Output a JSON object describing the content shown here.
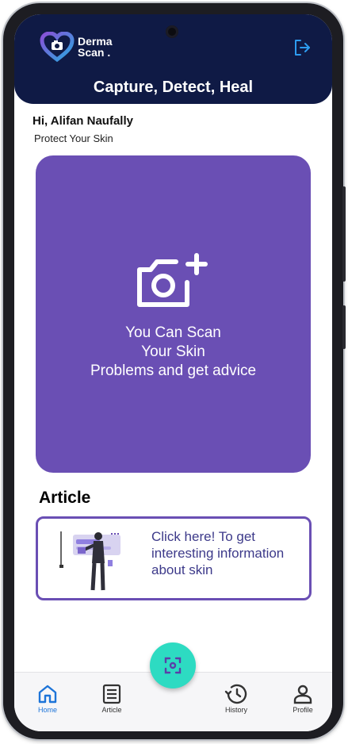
{
  "header": {
    "logo_line1": "Derma",
    "logo_line2": "Scan .",
    "title": "Capture, Detect, Heal",
    "logout_icon": "logout-icon"
  },
  "greeting": {
    "hello": "Hi, Alifan Naufally",
    "subtitle": "Protect Your Skin"
  },
  "scan_card": {
    "icon": "add-camera-icon",
    "line1": "You Can Scan",
    "line2": "Your Skin",
    "line3": "Problems and get advice"
  },
  "article": {
    "heading": "Article",
    "card_text": "Click here! To get interesting information about skin"
  },
  "bottom_nav": {
    "items": [
      {
        "label": "Home",
        "icon": "home-icon",
        "active": true
      },
      {
        "label": "Article",
        "icon": "article-icon",
        "active": false
      },
      {
        "label": "History",
        "icon": "history-icon",
        "active": false
      },
      {
        "label": "Profile",
        "icon": "profile-icon",
        "active": false
      }
    ],
    "fab_icon": "scan-icon"
  },
  "colors": {
    "header_bg": "#0f1a45",
    "card_purple": "#6a4fb4",
    "fab_teal": "#2ddbc2",
    "active_nav": "#1d74d8"
  }
}
